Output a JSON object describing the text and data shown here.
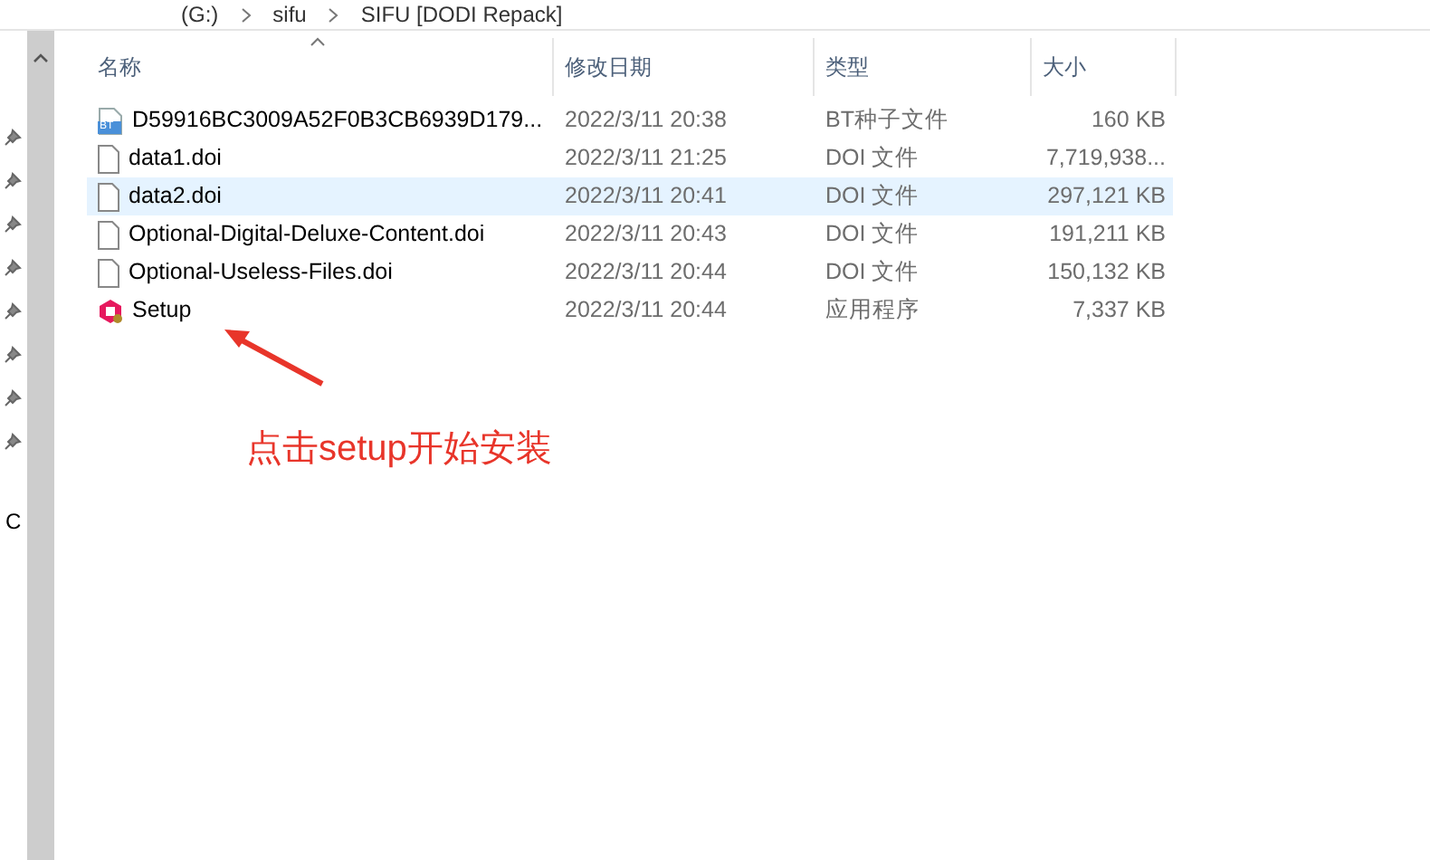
{
  "breadcrumb": [
    "(G:)",
    "sifu",
    "SIFU [DODI Repack]"
  ],
  "nav_pane": {
    "pinned_count_label": "C"
  },
  "columns": [
    "名称",
    "修改日期",
    "类型",
    "大小"
  ],
  "rows": [
    {
      "kind": "torrent",
      "badge": "BT",
      "name": "D59916BC3009A52F0B3CB6939D179...",
      "date": "2022/3/11 20:38",
      "type": "BT种子文件",
      "size": "160 KB",
      "selected": false
    },
    {
      "kind": "file",
      "name": "data1.doi",
      "date": "2022/3/11 21:25",
      "type": "DOI 文件",
      "size": "7,719,938...",
      "selected": false
    },
    {
      "kind": "file",
      "name": "data2.doi",
      "date": "2022/3/11 20:41",
      "type": "DOI 文件",
      "size": "297,121 KB",
      "selected": true
    },
    {
      "kind": "file",
      "name": "Optional-Digital-Deluxe-Content.doi",
      "date": "2022/3/11 20:43",
      "type": "DOI 文件",
      "size": "191,211 KB",
      "selected": false
    },
    {
      "kind": "file",
      "name": "Optional-Useless-Files.doi",
      "date": "2022/3/11 20:44",
      "type": "DOI 文件",
      "size": "150,132 KB",
      "selected": false
    },
    {
      "kind": "app",
      "name": "Setup",
      "date": "2022/3/11 20:44",
      "type": "应用程序",
      "size": "7,337 KB",
      "selected": false
    }
  ],
  "annotation": "点击setup开始安装"
}
